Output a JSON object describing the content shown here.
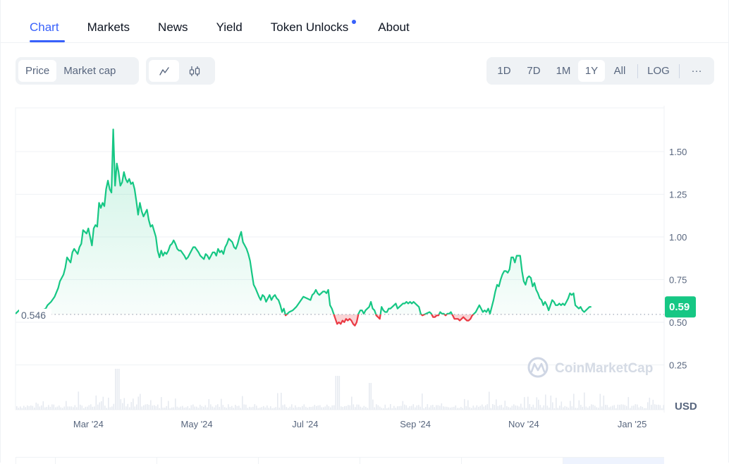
{
  "tabs": [
    {
      "label": "Chart",
      "active": true
    },
    {
      "label": "Markets"
    },
    {
      "label": "News"
    },
    {
      "label": "Yield"
    },
    {
      "label": "Token Unlocks",
      "badge_dot": true
    },
    {
      "label": "About"
    }
  ],
  "toolbar": {
    "data_type": [
      {
        "label": "Price",
        "active": true
      },
      {
        "label": "Market cap"
      }
    ],
    "chart_type": [
      {
        "icon": "line-chart-icon",
        "active": true
      },
      {
        "icon": "candlestick-icon"
      }
    ],
    "ranges": [
      {
        "label": "1D"
      },
      {
        "label": "7D"
      },
      {
        "label": "1M"
      },
      {
        "label": "1Y",
        "active": true
      },
      {
        "label": "All"
      }
    ],
    "log_label": "LOG",
    "more_label": "···"
  },
  "colors": {
    "accent": "#3861fb",
    "up": "#16c784",
    "down": "#ea3943",
    "axis_text": "#58667e",
    "grid": "#eff2f5",
    "volume": "#e4e8ef"
  },
  "chart_data": {
    "type": "line",
    "title": "",
    "currency_label": "USD",
    "watermark": "CoinMarketCap",
    "baseline_value": 0.546,
    "baseline_label": "0.546",
    "current_value": 0.59,
    "current_label": "0.59",
    "ylim": [
      0.0,
      1.72
    ],
    "yticks": [
      {
        "value": 0.25,
        "label": "0.25"
      },
      {
        "value": 0.5,
        "label": "0.50"
      },
      {
        "value": 0.75,
        "label": "0.75"
      },
      {
        "value": 1.0,
        "label": "1.00"
      },
      {
        "value": 1.25,
        "label": "1.25"
      },
      {
        "value": 1.5,
        "label": "1.50"
      }
    ],
    "xlim_days": [
      0,
      365
    ],
    "xticks": [
      {
        "day": 41,
        "label": "Mar '24"
      },
      {
        "day": 102,
        "label": "May '24"
      },
      {
        "day": 163,
        "label": "Jul '24"
      },
      {
        "day": 225,
        "label": "Sep '24"
      },
      {
        "day": 286,
        "label": "Nov '24"
      },
      {
        "day": 347,
        "label": "Jan '25"
      }
    ],
    "grid": true,
    "series": [
      {
        "name": "Price",
        "points": [
          [
            0,
            0.55
          ],
          [
            2,
            0.57
          ],
          [
            3,
            0.56
          ],
          [
            5,
            0.57
          ],
          [
            7,
            0.56
          ],
          [
            9,
            0.55
          ],
          [
            11,
            0.56
          ],
          [
            13,
            0.55
          ],
          [
            15,
            0.57
          ],
          [
            17,
            0.58
          ],
          [
            18,
            0.6
          ],
          [
            20,
            0.62
          ],
          [
            22,
            0.65
          ],
          [
            24,
            0.7
          ],
          [
            25,
            0.74
          ],
          [
            27,
            0.78
          ],
          [
            28,
            0.82
          ],
          [
            29,
            0.88
          ],
          [
            31,
            0.85
          ],
          [
            32,
            0.91
          ],
          [
            33,
            0.93
          ],
          [
            35,
            0.9
          ],
          [
            36,
            0.94
          ],
          [
            37,
            0.96
          ],
          [
            38,
            1.04
          ],
          [
            40,
            1.02
          ],
          [
            41,
            1.05
          ],
          [
            42,
            1.0
          ],
          [
            43,
            0.95
          ],
          [
            44,
            1.05
          ],
          [
            45,
            1.07
          ],
          [
            46,
            1.06
          ],
          [
            47,
            1.2
          ],
          [
            48,
            1.17
          ],
          [
            49,
            1.2
          ],
          [
            50,
            1.18
          ],
          [
            51,
            1.28
          ],
          [
            52,
            1.33
          ],
          [
            53,
            1.28
          ],
          [
            54,
            1.26
          ],
          [
            55,
            1.63
          ],
          [
            56,
            1.3
          ],
          [
            57,
            1.43
          ],
          [
            58,
            1.38
          ],
          [
            59,
            1.3
          ],
          [
            60,
            1.32
          ],
          [
            61,
            1.38
          ],
          [
            62,
            1.34
          ],
          [
            63,
            1.32
          ],
          [
            64,
            1.34
          ],
          [
            65,
            1.31
          ],
          [
            66,
            1.32
          ],
          [
            67,
            1.28
          ],
          [
            68,
            1.21
          ],
          [
            69,
            1.13
          ],
          [
            70,
            1.2
          ],
          [
            71,
            1.15
          ],
          [
            72,
            1.12
          ],
          [
            74,
            1.16
          ],
          [
            75,
            1.1
          ],
          [
            76,
            1.06
          ],
          [
            77,
            1.07
          ],
          [
            79,
            1.0
          ],
          [
            80,
            0.92
          ],
          [
            81,
            0.88
          ],
          [
            82,
            0.92
          ],
          [
            83,
            0.89
          ],
          [
            84,
            0.91
          ],
          [
            85,
            0.9
          ],
          [
            86,
            0.92
          ],
          [
            87,
            0.95
          ],
          [
            88,
            0.96
          ],
          [
            89,
            0.98
          ],
          [
            90,
            0.96
          ],
          [
            91,
            0.93
          ],
          [
            92,
            0.92
          ],
          [
            93,
            0.92
          ],
          [
            95,
            0.89
          ],
          [
            96,
            0.87
          ],
          [
            97,
            0.88
          ],
          [
            99,
            0.92
          ],
          [
            100,
            0.94
          ],
          [
            101,
            0.94
          ],
          [
            103,
            0.91
          ],
          [
            104,
            0.89
          ],
          [
            106,
            0.87
          ],
          [
            107,
            0.9
          ],
          [
            108,
            0.89
          ],
          [
            109,
            0.87
          ],
          [
            110,
            0.89
          ],
          [
            111,
            0.91
          ],
          [
            112,
            0.91
          ],
          [
            113,
            0.89
          ],
          [
            114,
            0.93
          ],
          [
            115,
            0.91
          ],
          [
            116,
            0.92
          ],
          [
            117,
            0.9
          ],
          [
            118,
            0.94
          ],
          [
            119,
            0.96
          ],
          [
            120,
            0.99
          ],
          [
            121,
            0.98
          ],
          [
            122,
            0.97
          ],
          [
            123,
            0.94
          ],
          [
            124,
            0.93
          ],
          [
            125,
            0.96
          ],
          [
            126,
            1.0
          ],
          [
            127,
            1.03
          ],
          [
            128,
            0.97
          ],
          [
            129,
            0.95
          ],
          [
            130,
            0.93
          ],
          [
            131,
            0.9
          ],
          [
            132,
            0.86
          ],
          [
            133,
            0.79
          ],
          [
            134,
            0.72
          ],
          [
            135,
            0.7
          ],
          [
            137,
            0.65
          ],
          [
            138,
            0.63
          ],
          [
            139,
            0.66
          ],
          [
            140,
            0.65
          ],
          [
            141,
            0.62
          ],
          [
            142,
            0.64
          ],
          [
            143,
            0.66
          ],
          [
            144,
            0.63
          ],
          [
            145,
            0.65
          ],
          [
            146,
            0.66
          ],
          [
            147,
            0.64
          ],
          [
            148,
            0.63
          ],
          [
            149,
            0.6
          ],
          [
            150,
            0.56
          ],
          [
            151,
            0.58
          ],
          [
            152,
            0.54
          ],
          [
            153,
            0.55
          ],
          [
            154,
            0.56
          ],
          [
            156,
            0.57
          ],
          [
            158,
            0.59
          ],
          [
            160,
            0.62
          ],
          [
            162,
            0.65
          ],
          [
            164,
            0.64
          ],
          [
            166,
            0.63
          ],
          [
            167,
            0.66
          ],
          [
            168,
            0.67
          ],
          [
            169,
            0.69
          ],
          [
            170,
            0.67
          ],
          [
            171,
            0.66
          ],
          [
            172,
            0.67
          ],
          [
            173,
            0.68
          ],
          [
            174,
            0.68
          ],
          [
            175,
            0.67
          ],
          [
            176,
            0.69
          ],
          [
            177,
            0.6
          ],
          [
            178,
            0.58
          ],
          [
            179,
            0.55
          ],
          [
            180,
            0.52
          ],
          [
            181,
            0.49
          ],
          [
            182,
            0.5
          ],
          [
            183,
            0.49
          ],
          [
            184,
            0.51
          ],
          [
            185,
            0.5
          ],
          [
            186,
            0.52
          ],
          [
            187,
            0.51
          ],
          [
            188,
            0.52
          ],
          [
            189,
            0.51
          ],
          [
            190,
            0.49
          ],
          [
            191,
            0.48
          ],
          [
            192,
            0.5
          ],
          [
            193,
            0.55
          ],
          [
            194,
            0.57
          ],
          [
            195,
            0.57
          ],
          [
            196,
            0.55
          ],
          [
            197,
            0.57
          ],
          [
            198,
            0.58
          ],
          [
            199,
            0.59
          ],
          [
            200,
            0.62
          ],
          [
            201,
            0.58
          ],
          [
            202,
            0.57
          ],
          [
            203,
            0.54
          ],
          [
            204,
            0.53
          ],
          [
            205,
            0.52
          ],
          [
            206,
            0.59
          ],
          [
            207,
            0.57
          ],
          [
            208,
            0.56
          ],
          [
            209,
            0.56
          ],
          [
            210,
            0.58
          ],
          [
            211,
            0.58
          ],
          [
            212,
            0.59
          ],
          [
            213,
            0.6
          ],
          [
            214,
            0.61
          ],
          [
            215,
            0.58
          ],
          [
            216,
            0.59
          ],
          [
            217,
            0.6
          ],
          [
            218,
            0.61
          ],
          [
            219,
            0.61
          ],
          [
            220,
            0.62
          ],
          [
            221,
            0.61
          ],
          [
            222,
            0.62
          ],
          [
            223,
            0.61
          ],
          [
            224,
            0.62
          ],
          [
            225,
            0.61
          ],
          [
            226,
            0.6
          ],
          [
            227,
            0.59
          ],
          [
            228,
            0.55
          ],
          [
            229,
            0.54
          ],
          [
            231,
            0.55
          ],
          [
            233,
            0.56
          ],
          [
            234,
            0.55
          ],
          [
            235,
            0.53
          ],
          [
            236,
            0.53
          ],
          [
            237,
            0.54
          ],
          [
            238,
            0.54
          ],
          [
            239,
            0.56
          ],
          [
            240,
            0.55
          ],
          [
            241,
            0.55
          ],
          [
            242,
            0.54
          ],
          [
            243,
            0.55
          ],
          [
            244,
            0.55
          ],
          [
            245,
            0.56
          ],
          [
            246,
            0.54
          ],
          [
            247,
            0.52
          ],
          [
            248,
            0.52
          ],
          [
            249,
            0.52
          ],
          [
            250,
            0.51
          ],
          [
            251,
            0.52
          ],
          [
            252,
            0.53
          ],
          [
            253,
            0.52
          ],
          [
            254,
            0.51
          ],
          [
            255,
            0.51
          ],
          [
            256,
            0.52
          ],
          [
            257,
            0.54
          ],
          [
            258,
            0.55
          ],
          [
            259,
            0.56
          ],
          [
            260,
            0.58
          ],
          [
            261,
            0.6
          ],
          [
            262,
            0.58
          ],
          [
            263,
            0.56
          ],
          [
            264,
            0.57
          ],
          [
            265,
            0.56
          ],
          [
            266,
            0.58
          ],
          [
            267,
            0.55
          ],
          [
            268,
            0.59
          ],
          [
            269,
            0.63
          ],
          [
            270,
            0.68
          ],
          [
            271,
            0.72
          ],
          [
            272,
            0.71
          ],
          [
            273,
            0.75
          ],
          [
            274,
            0.78
          ],
          [
            275,
            0.8
          ],
          [
            276,
            0.8
          ],
          [
            277,
            0.79
          ],
          [
            278,
            0.81
          ],
          [
            279,
            0.88
          ],
          [
            280,
            0.88
          ],
          [
            281,
            0.85
          ],
          [
            282,
            0.89
          ],
          [
            283,
            0.89
          ],
          [
            284,
            0.89
          ],
          [
            285,
            0.8
          ],
          [
            286,
            0.74
          ],
          [
            287,
            0.72
          ],
          [
            288,
            0.76
          ],
          [
            289,
            0.77
          ],
          [
            290,
            0.76
          ],
          [
            291,
            0.71
          ],
          [
            292,
            0.73
          ],
          [
            293,
            0.69
          ],
          [
            294,
            0.67
          ],
          [
            295,
            0.64
          ],
          [
            296,
            0.63
          ],
          [
            297,
            0.6
          ],
          [
            298,
            0.62
          ],
          [
            299,
            0.6
          ],
          [
            300,
            0.57
          ],
          [
            301,
            0.6
          ],
          [
            302,
            0.63
          ],
          [
            303,
            0.62
          ],
          [
            304,
            0.6
          ],
          [
            305,
            0.6
          ],
          [
            306,
            0.61
          ],
          [
            307,
            0.6
          ],
          [
            308,
            0.61
          ],
          [
            309,
            0.6
          ],
          [
            310,
            0.62
          ],
          [
            311,
            0.64
          ],
          [
            312,
            0.67
          ],
          [
            313,
            0.66
          ],
          [
            314,
            0.67
          ],
          [
            315,
            0.6
          ],
          [
            316,
            0.59
          ],
          [
            317,
            0.58
          ],
          [
            318,
            0.59
          ],
          [
            319,
            0.57
          ],
          [
            320,
            0.56
          ],
          [
            321,
            0.57
          ],
          [
            322,
            0.58
          ],
          [
            323,
            0.59
          ],
          [
            324,
            0.59
          ]
        ]
      }
    ],
    "volume_note": "daily volume bars shown beneath price line"
  }
}
